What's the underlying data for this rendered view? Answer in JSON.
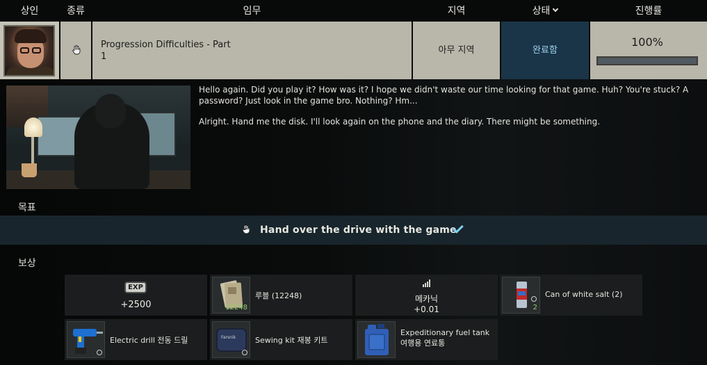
{
  "header": {
    "trader": "상인",
    "type": "종류",
    "quest": "임무",
    "location": "지역",
    "status": "상태",
    "progress": "진행률"
  },
  "quest": {
    "name": "Progression Difficulties - Part\n1",
    "location": "아무 지역",
    "status": "완료함",
    "progress_text": "100%",
    "progress_value": 1.0
  },
  "description": {
    "p1": "Hello again. Did you play it? How was it? I hope we didn't waste our time looking for that game. Huh? You're stuck? A password? Just look in the game bro. Nothing? Hm...",
    "p2": "Alright. Hand me the disk. I'll look again on the phone and the diary. There might be something."
  },
  "objectives": {
    "label": "목표",
    "items": [
      {
        "text": "Hand over the drive with the game",
        "done": true
      }
    ]
  },
  "rewards": {
    "label": "보상",
    "exp": {
      "badge": "EXP",
      "value": "+2500"
    },
    "rouble": {
      "name": "루블 (12248)",
      "count": "12248"
    },
    "skill": {
      "name": "메카닉",
      "value": "+0.01"
    },
    "salt": {
      "name": "Can of white salt (2)",
      "count": "2"
    },
    "drill": {
      "name": "Electric drill 전동 드릴"
    },
    "sewing": {
      "name": "Sewing kit 재봉 키트",
      "brand": "Farsnik"
    },
    "fuel": {
      "name": "Expeditionary fuel tank\n여행용 연료통"
    }
  },
  "colors": {
    "status_bg": "#1a3548",
    "status_text": "#9fd3ee",
    "objective_bg": "#18252c",
    "check": "#7fd0f0"
  }
}
